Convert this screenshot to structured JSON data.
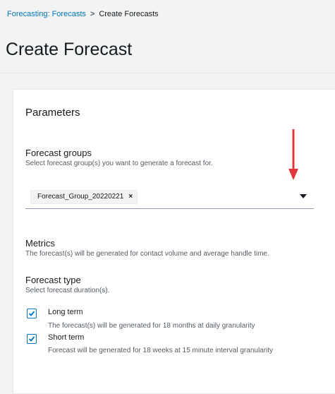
{
  "breadcrumb": {
    "parent": "Forecasting: Forecasts",
    "separator": ">",
    "current": "Create Forecasts"
  },
  "page": {
    "title": "Create Forecast"
  },
  "parameters": {
    "title": "Parameters",
    "forecast_groups": {
      "label": "Forecast groups",
      "description": "Select forecast group(s) you want to generate a forecast for.",
      "selected_token": "Forecast_Group_20220221",
      "token_remove": "×"
    },
    "metrics": {
      "label": "Metrics",
      "description": "The forecast(s) will be generated for contact volume and average handle time."
    },
    "forecast_type": {
      "label": "Forecast type",
      "description": "Select forecast duration(s).",
      "options": [
        {
          "label": "Long term",
          "description": "The forecast(s) will be generated for 18 months at daily granularity",
          "checked": true
        },
        {
          "label": "Short term",
          "description": "Forecast will be generated for 18 weeks at 15 minute interval granularity",
          "checked": true
        }
      ]
    }
  },
  "colors": {
    "link": "#0073bb",
    "accent_arrow": "#e0373a",
    "checkbox": "#0073bb"
  },
  "icons": {
    "dropdown": "caret-down-icon",
    "annotation": "red-down-arrow",
    "check": "checkmark-icon"
  }
}
